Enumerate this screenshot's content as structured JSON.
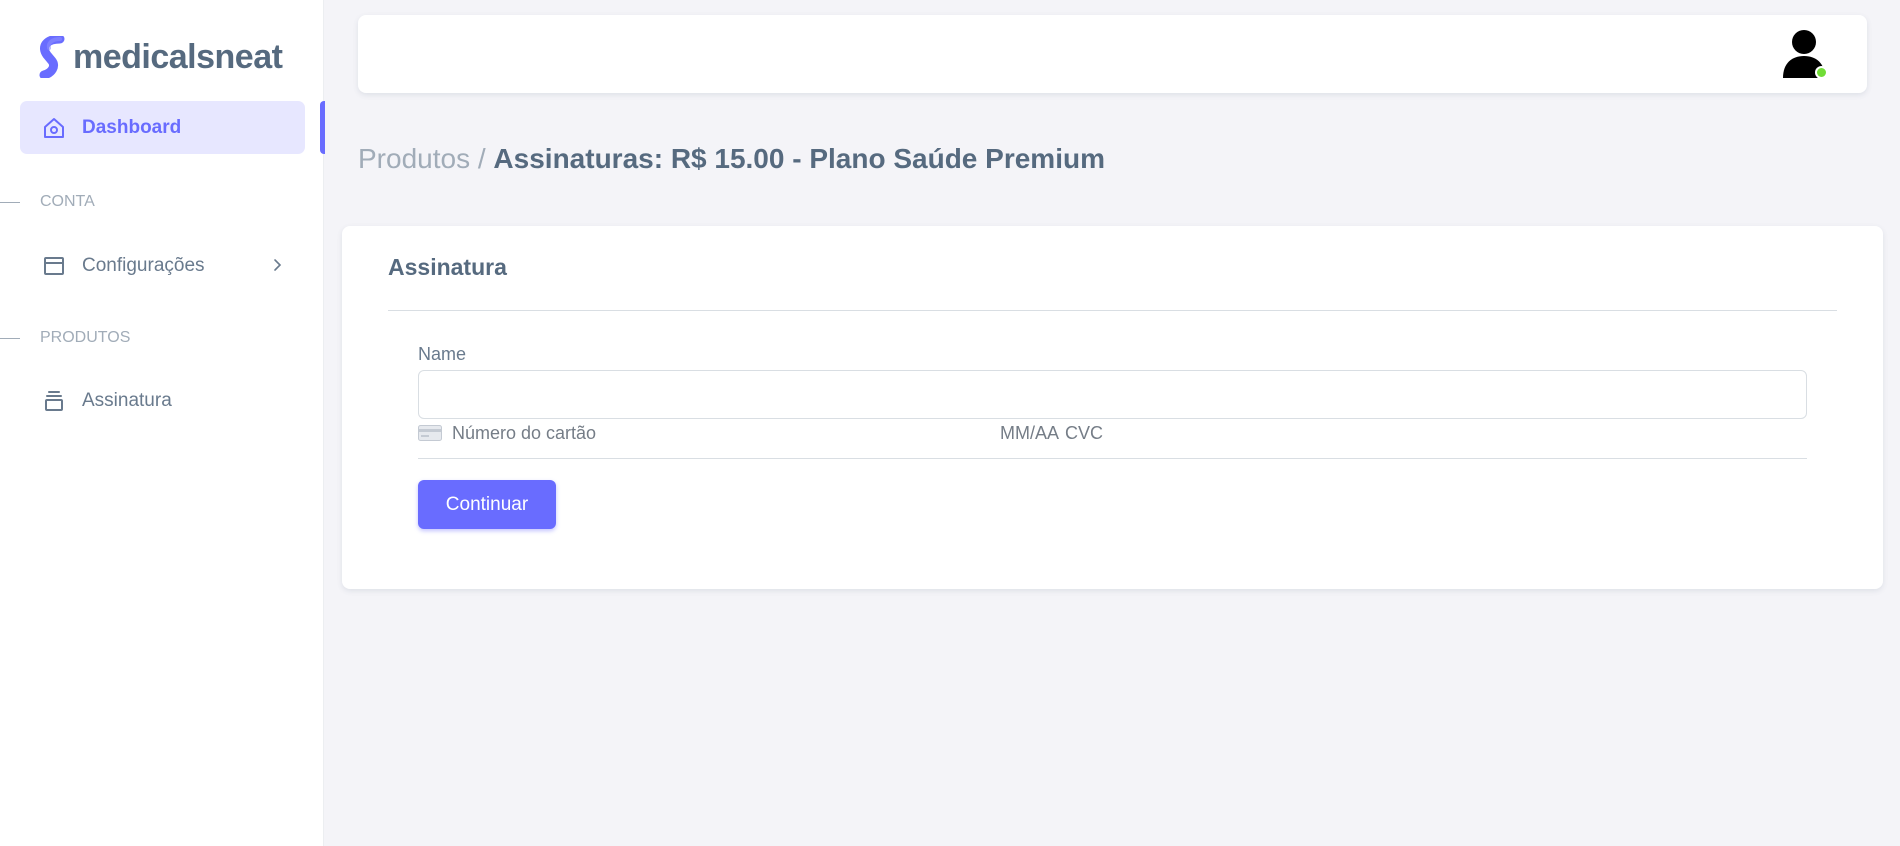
{
  "brand": {
    "name": "medicalsneat"
  },
  "colors": {
    "primary": "#696cff",
    "primary_light": "#e7e7ff",
    "text": "#566a7f",
    "muted": "#a1acb8",
    "online": "#71dd37",
    "background": "#f4f4f8"
  },
  "sidebar": {
    "items": [
      {
        "label": "Dashboard",
        "icon": "home-icon",
        "active": true
      },
      {
        "header": "CONTA"
      },
      {
        "label": "Configurações",
        "icon": "layout-icon",
        "has_submenu": true
      },
      {
        "header": "PRODUTOS"
      },
      {
        "label": "Assinatura",
        "icon": "stack-icon"
      }
    ]
  },
  "navbar": {
    "avatar_icon": "user-avatar-icon",
    "status": "online"
  },
  "breadcrumb": {
    "parent": "Produtos /",
    "current": "Assinaturas: R$ 15.00 - Plano Saúde Premium"
  },
  "card": {
    "title": "Assinatura",
    "name_label": "Name",
    "name_value": "",
    "card_number_placeholder": "Número do cartão",
    "expiry_placeholder": "MM/AA",
    "cvc_placeholder": "CVC",
    "submit_label": "Continuar"
  }
}
